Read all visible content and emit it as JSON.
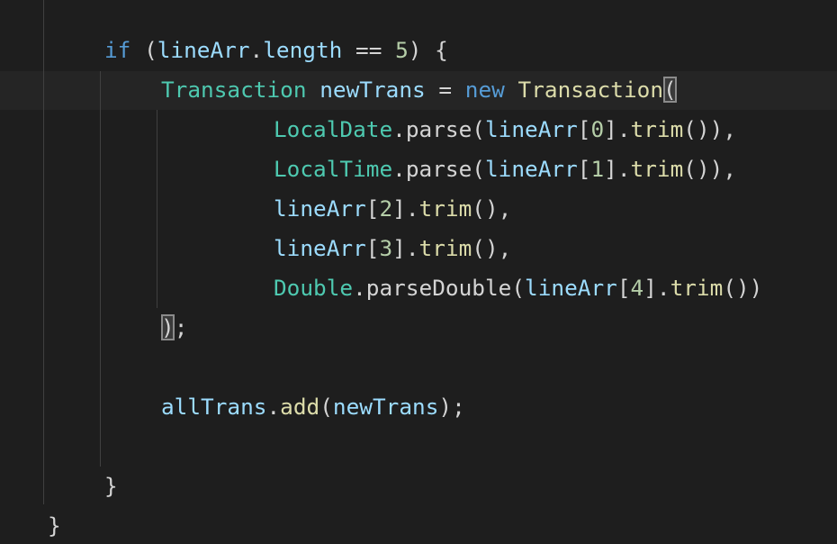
{
  "editor": {
    "lines": [
      {
        "tokens": [
          {
            "text": "if",
            "kind": "kw"
          },
          {
            "text": " ",
            "kind": "punc"
          },
          {
            "text": "(",
            "kind": "punc"
          },
          {
            "text": "lineArr",
            "kind": "var"
          },
          {
            "text": ".",
            "kind": "punc"
          },
          {
            "text": "length",
            "kind": "var"
          },
          {
            "text": " == ",
            "kind": "op"
          },
          {
            "text": "5",
            "kind": "num"
          },
          {
            "text": ") {",
            "kind": "punc"
          }
        ]
      },
      {
        "tokens": [
          {
            "text": "Transaction",
            "kind": "type"
          },
          {
            "text": " ",
            "kind": "punc"
          },
          {
            "text": "newTrans",
            "kind": "var"
          },
          {
            "text": " = ",
            "kind": "op"
          },
          {
            "text": "new",
            "kind": "kw"
          },
          {
            "text": " ",
            "kind": "punc"
          },
          {
            "text": "Transaction",
            "kind": "fn"
          },
          {
            "text": "(",
            "kind": "punc",
            "match": true
          }
        ]
      },
      {
        "tokens": [
          {
            "text": "LocalDate",
            "kind": "type"
          },
          {
            "text": ".parse(",
            "kind": "punc"
          },
          {
            "text": "lineArr",
            "kind": "var"
          },
          {
            "text": "[",
            "kind": "punc"
          },
          {
            "text": "0",
            "kind": "num"
          },
          {
            "text": "].",
            "kind": "punc"
          },
          {
            "text": "trim",
            "kind": "fn"
          },
          {
            "text": "()),",
            "kind": "punc"
          }
        ]
      },
      {
        "tokens": [
          {
            "text": "LocalTime",
            "kind": "type"
          },
          {
            "text": ".parse(",
            "kind": "punc"
          },
          {
            "text": "lineArr",
            "kind": "var"
          },
          {
            "text": "[",
            "kind": "punc"
          },
          {
            "text": "1",
            "kind": "num"
          },
          {
            "text": "].",
            "kind": "punc"
          },
          {
            "text": "trim",
            "kind": "fn"
          },
          {
            "text": "()),",
            "kind": "punc"
          }
        ]
      },
      {
        "tokens": [
          {
            "text": "lineArr",
            "kind": "var"
          },
          {
            "text": "[",
            "kind": "punc"
          },
          {
            "text": "2",
            "kind": "num"
          },
          {
            "text": "].",
            "kind": "punc"
          },
          {
            "text": "trim",
            "kind": "fn"
          },
          {
            "text": "(),",
            "kind": "punc"
          }
        ]
      },
      {
        "tokens": [
          {
            "text": "lineArr",
            "kind": "var"
          },
          {
            "text": "[",
            "kind": "punc"
          },
          {
            "text": "3",
            "kind": "num"
          },
          {
            "text": "].",
            "kind": "punc"
          },
          {
            "text": "trim",
            "kind": "fn"
          },
          {
            "text": "(),",
            "kind": "punc"
          }
        ]
      },
      {
        "tokens": [
          {
            "text": "Double",
            "kind": "type"
          },
          {
            "text": ".parseDouble(",
            "kind": "punc"
          },
          {
            "text": "lineArr",
            "kind": "var"
          },
          {
            "text": "[",
            "kind": "punc"
          },
          {
            "text": "4",
            "kind": "num"
          },
          {
            "text": "].",
            "kind": "punc"
          },
          {
            "text": "trim",
            "kind": "fn"
          },
          {
            "text": "())",
            "kind": "punc"
          }
        ]
      },
      {
        "tokens": [
          {
            "text": ")",
            "kind": "punc",
            "match": true
          },
          {
            "text": ";",
            "kind": "punc"
          }
        ]
      },
      {
        "tokens": []
      },
      {
        "tokens": [
          {
            "text": "allTrans",
            "kind": "var"
          },
          {
            "text": ".",
            "kind": "punc"
          },
          {
            "text": "add",
            "kind": "fn"
          },
          {
            "text": "(",
            "kind": "punc"
          },
          {
            "text": "newTrans",
            "kind": "var"
          },
          {
            "text": ");",
            "kind": "punc"
          }
        ]
      },
      {
        "tokens": []
      },
      {
        "tokens": [
          {
            "text": "}",
            "kind": "punc"
          }
        ]
      },
      {
        "tokens": [
          {
            "text": "}",
            "kind": "punc"
          }
        ]
      }
    ]
  },
  "colors": {
    "background": "#1e1e1e",
    "current_line": "#252525",
    "keyword": "#569cd6",
    "variable": "#9cdcfe",
    "type": "#4ec9b0",
    "function": "#dcdcaa",
    "number": "#b5cea8",
    "punctuation": "#d4d4d4"
  }
}
